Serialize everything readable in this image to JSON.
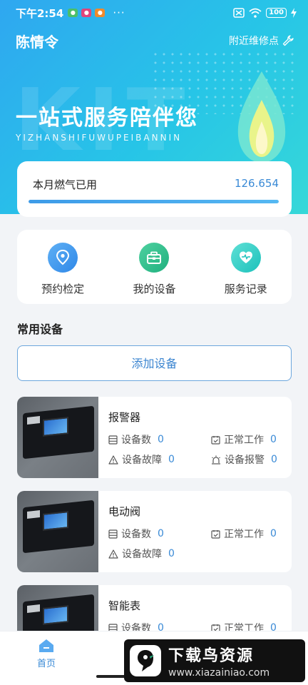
{
  "status_bar": {
    "time": "下午2:54",
    "more": "···",
    "battery": "100"
  },
  "header": {
    "city": "陈情令",
    "nearby_label": "附近维修点"
  },
  "hero": {
    "slogan": "一站式服务陪伴您",
    "slogan_sub": "YIZHANSHIFUWUPEIBANNIN",
    "watermark": "KIT"
  },
  "usage": {
    "label": "本月燃气已用",
    "value": "126.654",
    "progress_fraction": 1.0
  },
  "quick_actions": [
    {
      "label": "预约检定",
      "icon": "location-pin-icon"
    },
    {
      "label": "我的设备",
      "icon": "toolbox-icon"
    },
    {
      "label": "服务记录",
      "icon": "heart-icon"
    }
  ],
  "section": {
    "title": "常用设备",
    "add_button": "添加设备"
  },
  "devices": [
    {
      "name": "报警器",
      "stats": [
        {
          "label": "设备数",
          "value": "0"
        },
        {
          "label": "正常工作",
          "value": "0"
        },
        {
          "label": "设备故障",
          "value": "0"
        },
        {
          "label": "设备报警",
          "value": "0"
        }
      ]
    },
    {
      "name": "电动阀",
      "stats": [
        {
          "label": "设备数",
          "value": "0"
        },
        {
          "label": "正常工作",
          "value": "0"
        },
        {
          "label": "设备故障",
          "value": "0"
        }
      ]
    },
    {
      "name": "智能表",
      "stats": [
        {
          "label": "设备数",
          "value": "0"
        },
        {
          "label": "正常工作",
          "value": "0"
        }
      ]
    }
  ],
  "bottom_nav": {
    "home_label": "首页"
  },
  "promo": {
    "title": "下载鸟资源",
    "url": "www.xiazainiao.com"
  },
  "colors": {
    "accent": "#3a8ad6",
    "hero_start": "#2fa7f0",
    "hero_end": "#36d8d8"
  }
}
